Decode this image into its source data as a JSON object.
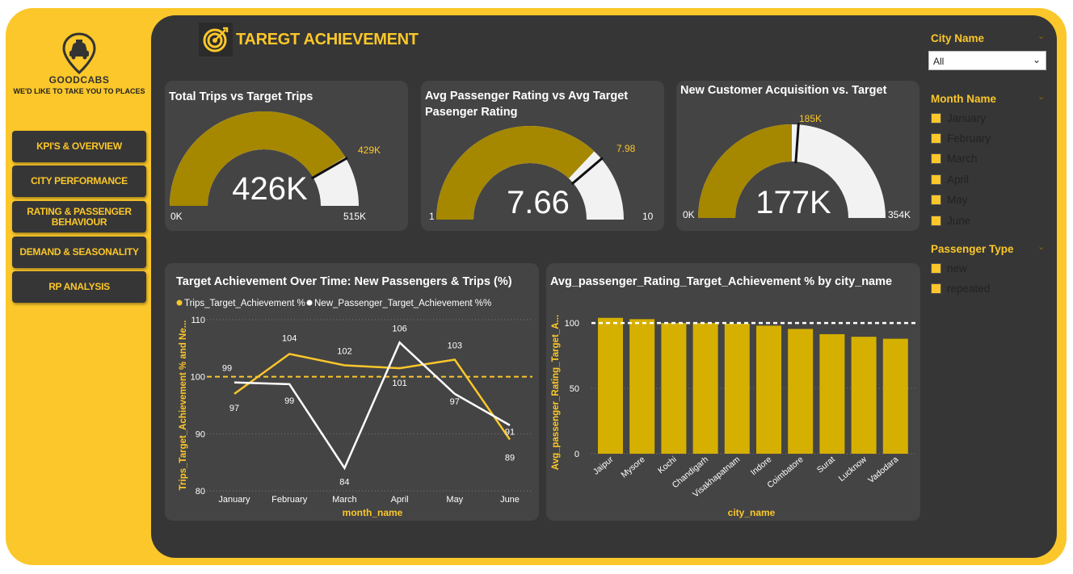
{
  "brand": {
    "name": "GOODCABS",
    "tagline": "WE'D LIKE TO TAKE YOU TO PLACES"
  },
  "nav": [
    {
      "label": "KPI'S & OVERVIEW"
    },
    {
      "label": "CITY PERFORMANCE"
    },
    {
      "label": "RATING & PASSENGER BEHAVIOUR"
    },
    {
      "label": "DEMAND & SEASONALITY"
    },
    {
      "label": "RP ANALYSIS"
    }
  ],
  "page": {
    "title": "TAREGT ACHIEVEMENT"
  },
  "colors": {
    "accent": "#fbc72a",
    "gaugeFill": "#a58700",
    "bar": "#d6b000",
    "panel": "#363636",
    "card": "#444444"
  },
  "gauges": [
    {
      "title": "Total Trips vs Target Trips",
      "value_label": "426K",
      "min_label": "0K",
      "max_label": "515K",
      "target_label": "429K",
      "value": 426,
      "min": 0,
      "max": 515,
      "target": 429
    },
    {
      "title": "Avg Passenger Rating vs Avg Target Pasenger Rating",
      "value_label": "7.66",
      "min_label": "1",
      "max_label": "10",
      "target_label": "7.98",
      "value": 7.66,
      "min": 1,
      "max": 10,
      "target": 7.98
    },
    {
      "title": "New Customer Acquisition vs. Target",
      "value_label": "177K",
      "min_label": "0K",
      "max_label": "354K",
      "target_label": "185K",
      "value": 177,
      "min": 0,
      "max": 354,
      "target": 185
    }
  ],
  "line_card": {
    "title": "Target Achievement Over Time: New Passengers & Trips (%)"
  },
  "bar_card": {
    "title": "Avg_passenger_Rating_Target_Achievement % by city_name"
  },
  "chart_data": [
    {
      "type": "line",
      "title": "Target Achievement Over Time: New Passengers & Trips (%)",
      "xlabel": "month_name",
      "ylabel": "Trips_Target_Achievement % and Ne...",
      "categories": [
        "January",
        "February",
        "March",
        "April",
        "May",
        "June"
      ],
      "series": [
        {
          "name": "Trips_Target_Achievement %",
          "values": [
            97,
            104,
            102,
            101.5,
            103,
            89
          ]
        },
        {
          "name": "New_Passenger_Target_Achievement %%",
          "values": [
            99,
            98.7,
            84,
            106,
            97,
            91.5
          ]
        }
      ],
      "point_labels": [
        [
          "97",
          "104",
          "102",
          "101",
          "103",
          "89"
        ],
        [
          "99",
          "99",
          "84",
          "106",
          "97",
          "91"
        ]
      ],
      "yticks": [
        "80",
        "90",
        "100",
        "110"
      ],
      "ylim": [
        80,
        110
      ],
      "reference_line": 100,
      "legend": "top-left",
      "grid": true
    },
    {
      "type": "bar",
      "title": "Avg_passenger_Rating_Target_Achievement % by city_name",
      "xlabel": "city_name",
      "ylabel": "Avg_passenger_Rating_Target_A...",
      "categories": [
        "Jaipur",
        "Mysore",
        "Kochi",
        "Chandigarh",
        "Visakhapatnam",
        "Indore",
        "Coimbatore",
        "Surat",
        "Lucknow",
        "Vadodara"
      ],
      "values": [
        104,
        103,
        100,
        100,
        99.5,
        98,
        95.5,
        91.5,
        89.5,
        88
      ],
      "yticks": [
        "0",
        "50",
        "100"
      ],
      "ylim": [
        0,
        110
      ],
      "reference_line": 100,
      "grid": true
    }
  ],
  "slicers": {
    "city": {
      "title": "City Name",
      "selected": "All"
    },
    "month": {
      "title": "Month Name",
      "options": [
        "January",
        "February",
        "March",
        "April",
        "May",
        "June"
      ]
    },
    "passenger": {
      "title": "Passenger Type",
      "options": [
        "new",
        "repeated"
      ]
    }
  }
}
